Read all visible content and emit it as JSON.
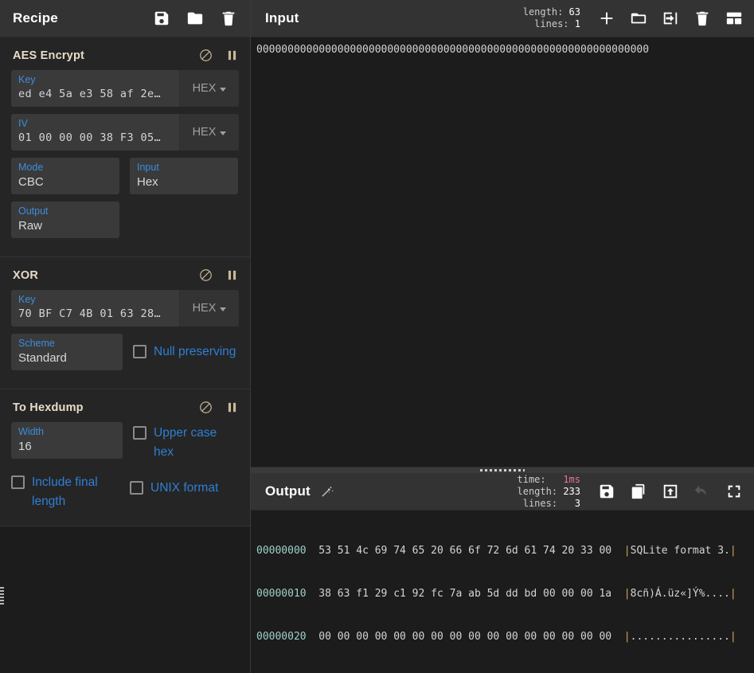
{
  "recipe": {
    "title": "Recipe",
    "icons": [
      {
        "name": "save-recipe-icon",
        "glyph": "save"
      },
      {
        "name": "load-recipe-icon",
        "glyph": "folder"
      },
      {
        "name": "clear-recipe-icon",
        "glyph": "trash"
      }
    ],
    "operations": [
      {
        "name": "AES Encrypt",
        "disable_icon": "disable-operation-icon",
        "breakpoint_icon": "breakpoint-icon",
        "args": {
          "key_label": "Key",
          "key_value": "ed e4 5a e3 58 af 2e…",
          "key_type": "HEX",
          "iv_label": "IV",
          "iv_value": "01 00 00 00 38 F3 05…",
          "iv_type": "HEX",
          "mode_label": "Mode",
          "mode_value": "CBC",
          "input_label": "Input",
          "input_value": "Hex",
          "output_label": "Output",
          "output_value": "Raw"
        }
      },
      {
        "name": "XOR",
        "disable_icon": "disable-operation-icon",
        "breakpoint_icon": "breakpoint-icon",
        "args": {
          "key_label": "Key",
          "key_value": "70 BF C7 4B 01 63 28…",
          "key_type": "HEX",
          "scheme_label": "Scheme",
          "scheme_value": "Standard",
          "null_preserving_label": "Null preserving",
          "null_preserving_checked": false
        }
      },
      {
        "name": "To Hexdump",
        "disable_icon": "disable-operation-icon",
        "breakpoint_icon": "breakpoint-icon",
        "args": {
          "width_label": "Width",
          "width_value": "16",
          "upper_case_hex_label": "Upper case hex",
          "upper_case_hex_checked": false,
          "include_final_length_label": "Include final length",
          "include_final_length_checked": false,
          "unix_format_label": "UNIX format",
          "unix_format_checked": false
        }
      }
    ]
  },
  "input": {
    "title": "Input",
    "meta": {
      "length_key": "length:",
      "length_value": "63",
      "lines_key": "lines:",
      "lines_value": "1"
    },
    "value": "000000000000000000000000000000000000000000000000000000000000000",
    "icons": [
      {
        "name": "add-input-tab-icon",
        "glyph": "plus"
      },
      {
        "name": "open-folder-icon",
        "glyph": "folder"
      },
      {
        "name": "open-input-icon",
        "glyph": "open-in"
      },
      {
        "name": "clear-input-icon",
        "glyph": "trash"
      },
      {
        "name": "reset-layout-icon",
        "glyph": "layout"
      }
    ]
  },
  "output": {
    "title": "Output",
    "magic_icon": "magic-wand-icon",
    "meta": {
      "time_key": "time:",
      "time_value": "1ms",
      "length_key": "length:",
      "length_value": "233",
      "lines_key": "lines:",
      "lines_value": "3"
    },
    "icons": [
      {
        "name": "save-output-icon",
        "glyph": "save"
      },
      {
        "name": "copy-output-icon",
        "glyph": "copy"
      },
      {
        "name": "replace-input-icon",
        "glyph": "replace-input"
      },
      {
        "name": "undo-icon",
        "glyph": "undo",
        "disabled": true
      },
      {
        "name": "maximise-output-icon",
        "glyph": "maximise"
      }
    ],
    "hexdump": [
      {
        "offset": "00000000",
        "bytes": "53 51 4c 69 74 65 20 66 6f 72 6d 61 74 20 33 00",
        "ascii": "SQLite format 3."
      },
      {
        "offset": "00000010",
        "bytes": "38 63 f1 29 c1 92 fc 7a ab 5d dd bd 00 00 00 1a",
        "ascii": "8cñ)Á.üz«]Ý%...."
      },
      {
        "offset": "00000020",
        "bytes": "00 00 00 00 00 00 00 00 00 00 00 00 00 00 00 00",
        "ascii": "................"
      }
    ]
  },
  "colors": {
    "accent_blue": "#3c8ddc",
    "op_title": "#e8dcc8",
    "panel_bg": "#1c1c1c",
    "op_bg": "#252525",
    "titlebar_bg": "#333333",
    "field_bg": "#3a3a3a",
    "hexdump_offset": "#9fd0c8",
    "hexdump_pipe": "#d8a657",
    "time_value": "#e86ea4"
  }
}
